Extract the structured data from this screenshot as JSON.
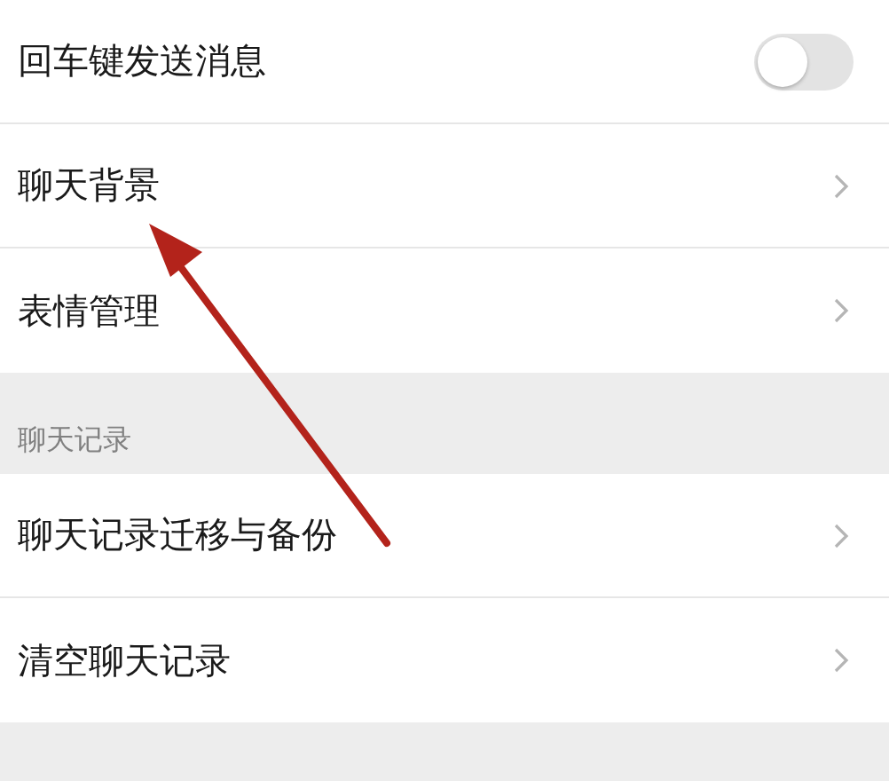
{
  "sections": [
    {
      "items": [
        {
          "kind": "toggle",
          "label": "回车键发送消息",
          "on": false
        },
        {
          "kind": "link",
          "label": "聊天背景"
        },
        {
          "kind": "link",
          "label": "表情管理"
        }
      ]
    },
    {
      "header": "聊天记录",
      "items": [
        {
          "kind": "link",
          "label": "聊天记录迁移与备份"
        },
        {
          "kind": "link",
          "label": "清空聊天记录"
        }
      ]
    }
  ]
}
